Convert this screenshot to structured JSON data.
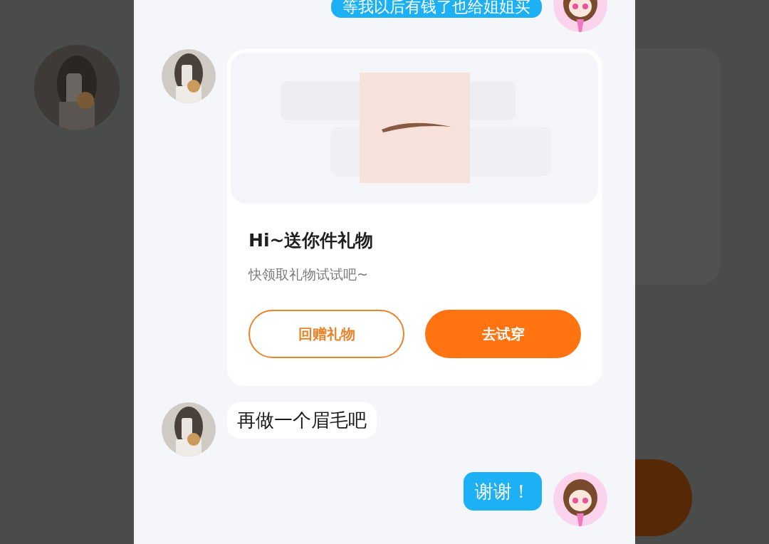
{
  "messages": [
    {
      "kind": "text",
      "outgoing": true,
      "text": "等我以后有钱了也给姐姐买"
    },
    {
      "kind": "gift_card",
      "outgoing": false,
      "title": "Hi~送你件礼物",
      "subtitle": "快领取礼物试试吧~",
      "buttons": [
        {
          "label": "回赠礼物",
          "kind": "outline"
        },
        {
          "label": "去试穿",
          "kind": "filled"
        }
      ]
    },
    {
      "kind": "text",
      "outgoing": false,
      "text": "再做一个眉毛吧"
    },
    {
      "kind": "text",
      "outgoing": true,
      "text": "谢谢！"
    }
  ]
}
